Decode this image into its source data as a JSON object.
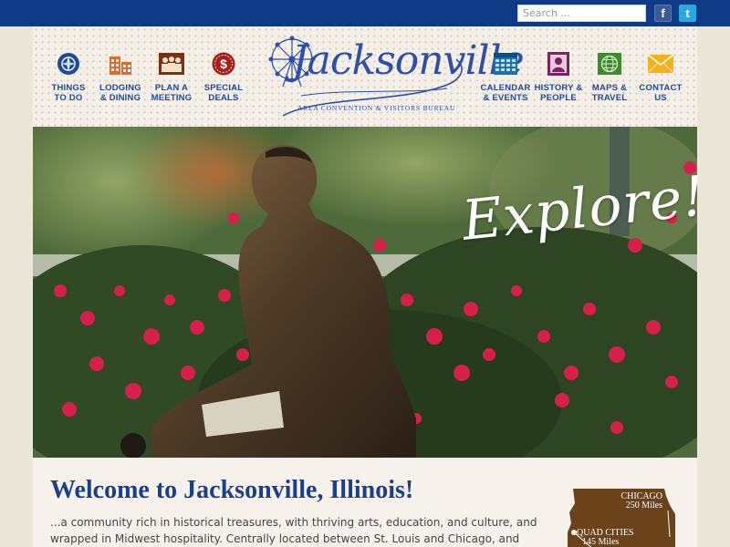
{
  "topbar": {
    "search_placeholder": "Search ...",
    "facebook_icon": "facebook-icon",
    "twitter_icon": "twitter-icon",
    "facebook_glyph": "f",
    "twitter_glyph": "t"
  },
  "nav_left": [
    {
      "label": "THINGS\nTO DO",
      "icon": "compass-icon"
    },
    {
      "label": "LODGING\n& DINING",
      "icon": "buildings-icon"
    },
    {
      "label": "PLAN A\nMEETING",
      "icon": "people-icon"
    },
    {
      "label": "SPECIAL\nDEALS",
      "icon": "dollar-icon"
    }
  ],
  "nav_right": [
    {
      "label": "CALENDAR\n& EVENTS",
      "icon": "calendar-icon"
    },
    {
      "label": "HISTORY &\nPEOPLE",
      "icon": "portrait-icon"
    },
    {
      "label": "MAPS &\nTRAVEL",
      "icon": "globe-icon"
    },
    {
      "label": "CONTACT\nUS",
      "icon": "envelope-icon"
    }
  ],
  "logo": {
    "name": "Jacksonville",
    "subtitle": "AREA CONVENTION & VISITORS BUREAU"
  },
  "hero": {
    "tagline": "Explore!"
  },
  "welcome": {
    "title": "Welcome to Jacksonville, Illinois!",
    "intro": "...a community rich in historical treasures, with thriving arts, education, and culture, and wrapped in Midwest hospitality. Centrally located between St. Louis and Chicago, and near Springfield,"
  },
  "map": {
    "city1_name": "CHICAGO",
    "city1_distance": "250 Miles",
    "city2_name": "QUAD CITIES",
    "city2_distance": "145 Miles"
  },
  "colors": {
    "topbar": "#0f3a86",
    "nav_text": "#1f4a98",
    "heading": "#1c3f8a",
    "map_fill": "#6b4219"
  }
}
